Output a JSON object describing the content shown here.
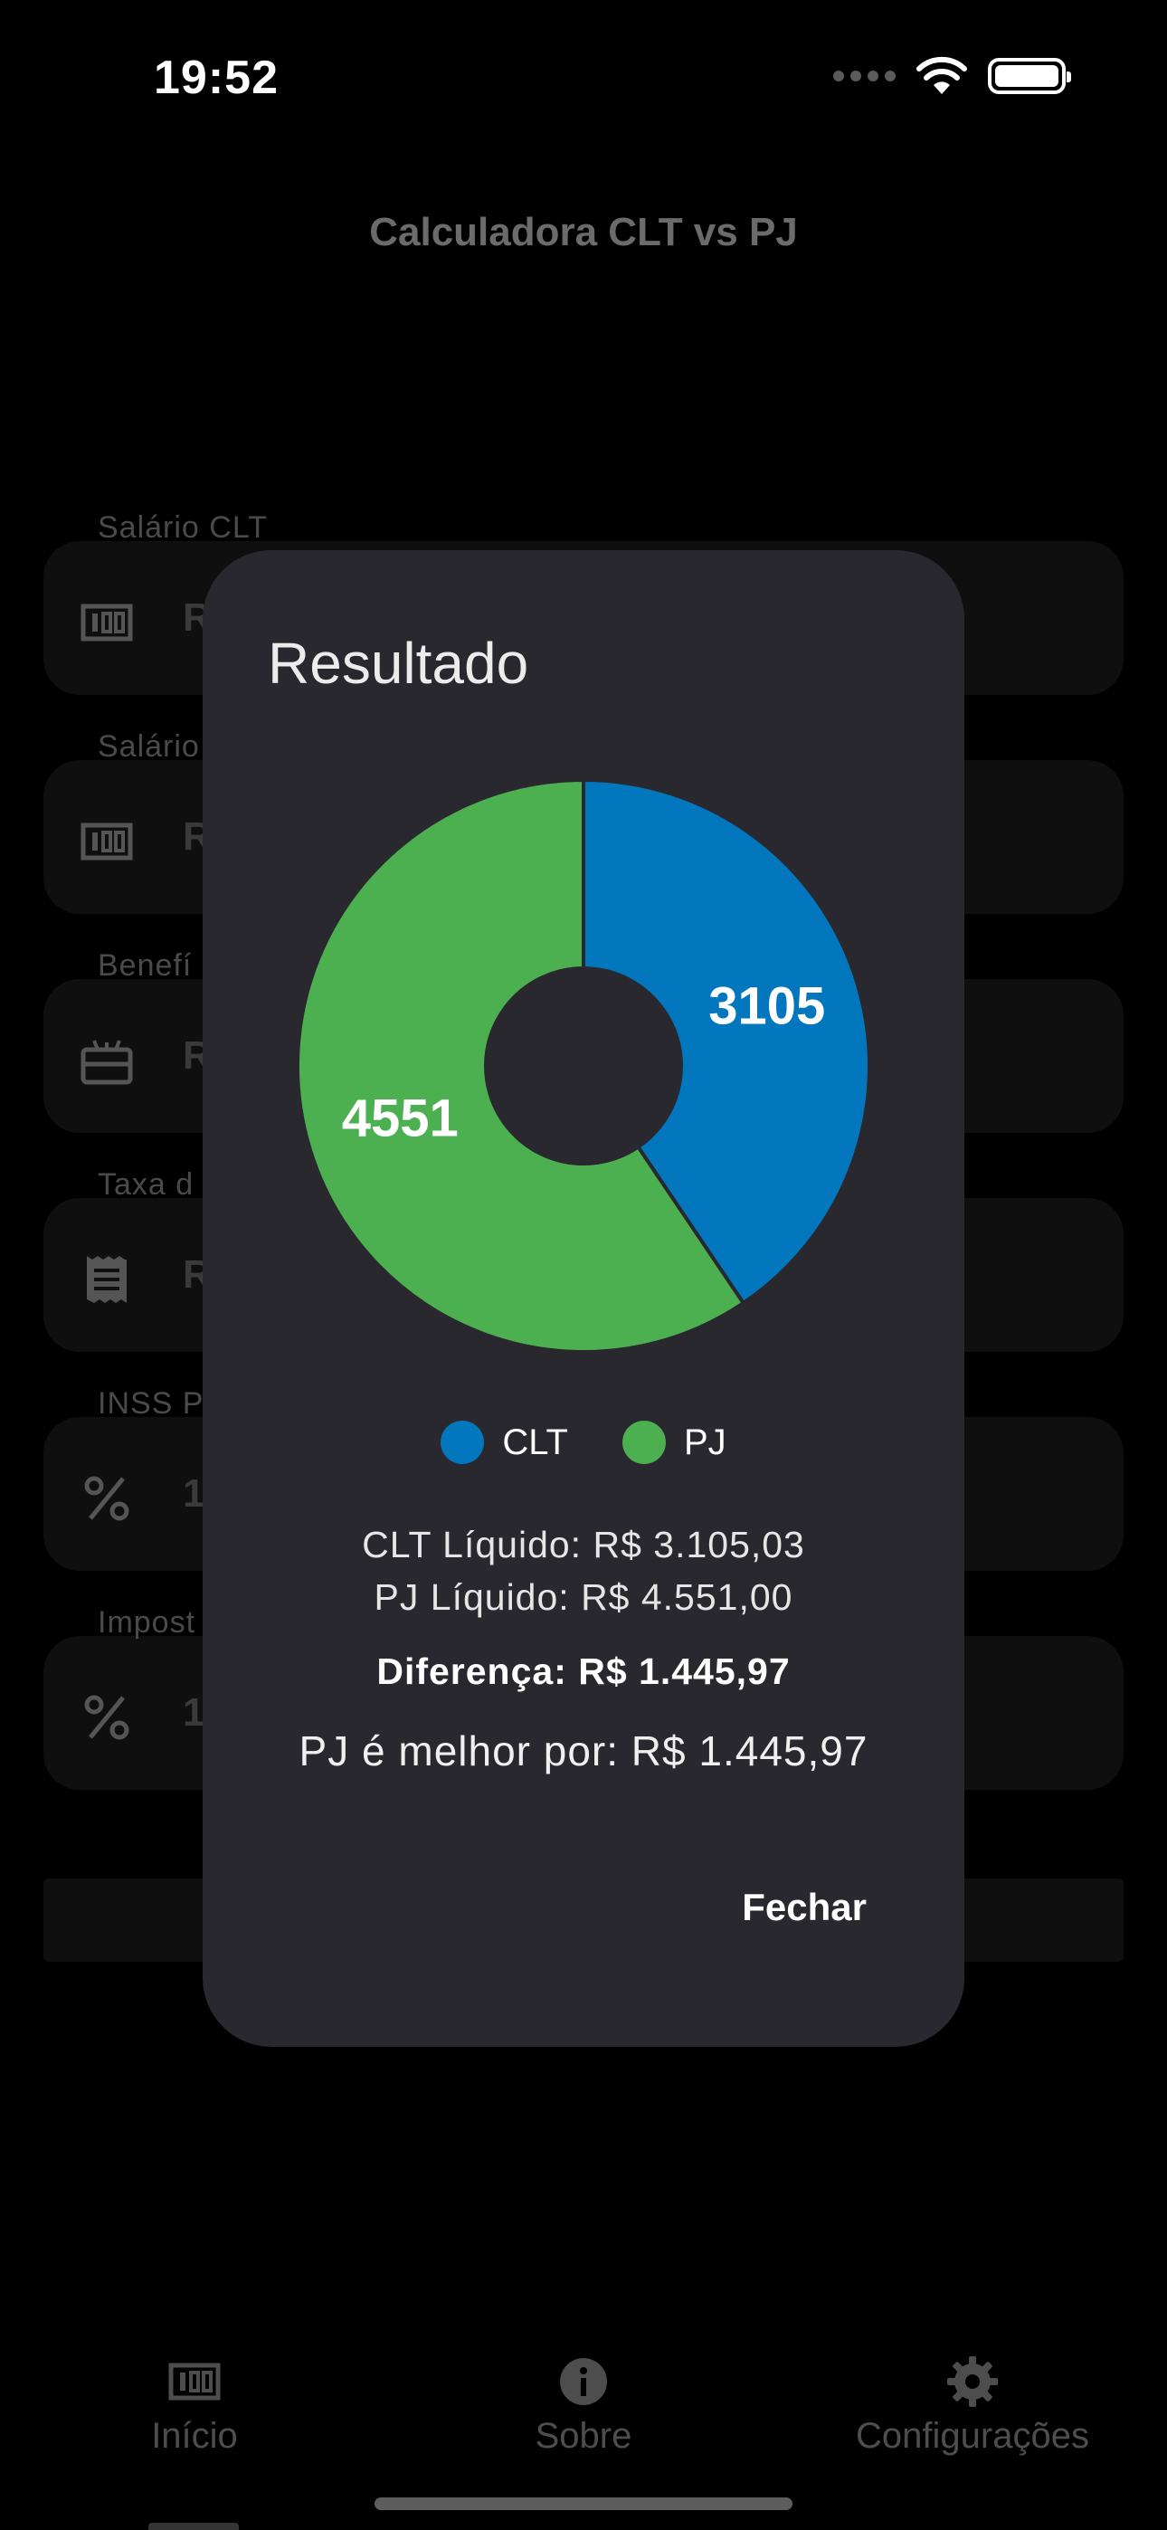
{
  "status_bar": {
    "time": "19:52"
  },
  "app": {
    "title": "Calculadora CLT vs PJ"
  },
  "form": {
    "fields": [
      {
        "label": "Salário CLT",
        "icon": "money-icon",
        "value": "R"
      },
      {
        "label": "Salário",
        "icon": "money-icon",
        "value": "R"
      },
      {
        "label": "Benefí",
        "icon": "gift-icon",
        "value": "R"
      },
      {
        "label": "Taxa d",
        "icon": "receipt-icon",
        "value": "R"
      },
      {
        "label": "INSS P",
        "icon": "percent-icon",
        "value": "1"
      },
      {
        "label": "Impost",
        "icon": "percent-icon",
        "value": "1"
      }
    ]
  },
  "nav": {
    "items": [
      {
        "label": "Início",
        "icon": "money-icon"
      },
      {
        "label": "Sobre",
        "icon": "info-icon"
      },
      {
        "label": "Configurações",
        "icon": "gear-icon"
      }
    ]
  },
  "dialog": {
    "title": "Resultado",
    "clt_line": "CLT Líquido: R$  3.105,03",
    "pj_line": "PJ Líquido: R$  4.551,00",
    "diff_line": "Diferença: R$  1.445,97",
    "better_line": "PJ é melhor por: R$ 1.445,97",
    "close_label": "Fechar"
  },
  "chart_data": {
    "type": "pie",
    "donut": true,
    "slices": [
      {
        "name": "CLT",
        "value": 3105,
        "label": "3105",
        "color": "#0277bd"
      },
      {
        "name": "PJ",
        "value": 4551,
        "label": "4551",
        "color": "#4caf50"
      }
    ],
    "legend": [
      "CLT",
      "PJ"
    ],
    "legend_position": "bottom"
  }
}
